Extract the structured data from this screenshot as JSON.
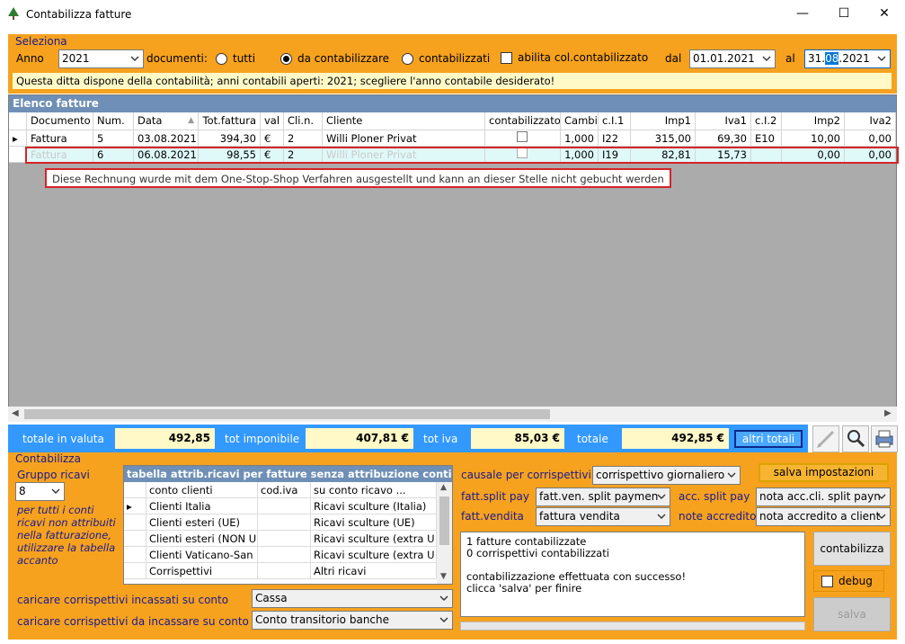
{
  "window": {
    "title": "Contabilizza fatture",
    "minimize": "—",
    "maximize": "☐",
    "close": "✕"
  },
  "seleziona": {
    "group_label": "Seleziona",
    "anno_label": "Anno",
    "anno_value": "2021",
    "documenti_label": "documenti:",
    "radio_tutti": "tutti",
    "radio_da": "da contabilizzare",
    "radio_cont": "contabilizzati",
    "selected_radio": "da contabilizzare",
    "abilita_label": "abilita col.contabilizzato",
    "dal_label": "dal",
    "dal_value": "01.01.2021",
    "al_label": "al",
    "al_value_a": "31.",
    "al_value_b": "08",
    "al_value_c": ".2021",
    "info": "Questa ditta dispone della contabilità; anni contabili aperti: 2021; scegliere l'anno contabile desiderato!"
  },
  "elenco": {
    "title": "Elenco fatture",
    "columns": [
      "Documento",
      "Num.",
      "Data",
      "Tot.fattura",
      "val",
      "Cli.n.",
      "Cliente",
      "contabilizzato",
      "Cambi",
      "c.I.1",
      "Imp1",
      "Iva1",
      "c.I.2",
      "Imp2",
      "Iva2"
    ],
    "rows": [
      {
        "documento": "Fattura",
        "num": "5",
        "data": "03.08.2021",
        "tot": "394,30",
        "val": "€",
        "clin": "2",
        "cliente": "Willi Ploner Privat",
        "cambi": "1,000",
        "ci1": "I22",
        "imp1": "315,00",
        "iva1": "69,30",
        "ci2": "E10",
        "imp2": "10,00",
        "iva2": "0,00"
      },
      {
        "documento": "Fattura",
        "num": "6",
        "data": "06.08.2021",
        "tot": "98,55",
        "val": "€",
        "clin": "2",
        "cliente": "Willi Ploner Privat",
        "cambi": "1,000",
        "ci1": "I19",
        "imp1": "82,81",
        "iva1": "15,73",
        "ci2": "",
        "imp2": "0,00",
        "iva2": "0,00"
      }
    ],
    "tooltip": "Diese Rechnung wurde mit dem One-Stop-Shop Verfahren ausgestellt und kann an dieser Stelle nicht gebucht werden"
  },
  "totals": {
    "valuta_label": "totale in valuta",
    "valuta_value": "492,85",
    "imponibile_label": "tot imponibile",
    "imponibile_value": "407,81 €",
    "iva_label": "tot iva",
    "iva_value": "85,03 €",
    "totale_label": "totale",
    "totale_value": "492,85 €",
    "altri_totali": "altri totali"
  },
  "contabilizza": {
    "group_label": "Contabilizza",
    "gruppo_ricavi_label": "Gruppo ricavi",
    "gruppo_ricavi_value": "8",
    "note": "per tutti i conti ricavi non attribuiti nella fatturazione, utilizzare la tabella accanto",
    "table_title": "tabella attrib.ricavi per fatture senza attribuzione conti",
    "table_columns": [
      "conto clienti",
      "cod.iva",
      "su conto ricavo ..."
    ],
    "table_rows": [
      {
        "conto": "Clienti Italia",
        "codiva": "",
        "ricavo": "Ricavi sculture (Italia)"
      },
      {
        "conto": "Clienti esteri (UE)",
        "codiva": "",
        "ricavo": "Ricavi sculture (UE)"
      },
      {
        "conto": "Clienti esteri (NON U",
        "codiva": "",
        "ricavo": "Ricavi sculture (extra U"
      },
      {
        "conto": "Clienti Vaticano-San",
        "codiva": "",
        "ricavo": "Ricavi sculture (extra U"
      },
      {
        "conto": "Corrispettivi",
        "codiva": "",
        "ricavo": "Altri ricavi"
      }
    ],
    "incassati_label": "caricare corrispettivi incassati su conto",
    "incassati_value": "Cassa",
    "da_incassare_label": "caricare corrispettivi da incassare su conto",
    "da_incassare_value": "Conto transitorio banche",
    "causale_label": "causale per corrispettivi",
    "causale_value": "corrispettivo giornaliero",
    "salva_impostazioni": "salva impostazioni",
    "split_pay_label": "fatt.split pay",
    "split_pay_value": "fatt.ven. split paymen",
    "acc_split_label": "acc. split pay",
    "acc_split_value": "nota acc.cli. split payn",
    "vendita_label": "fatt.vendita",
    "vendita_value": "fattura vendita",
    "accredito_label": "note accredito",
    "accredito_value": "nota accredito a client",
    "message": "1 fatture contabilizzate\n0 corrispettivi contabilizzati\n\ncontabilizzazione effettuata con successo!\nclicca 'salva' per finire",
    "contabilizza_button": "contabilizza",
    "debug_label": "debug",
    "salva_button": "salva"
  }
}
